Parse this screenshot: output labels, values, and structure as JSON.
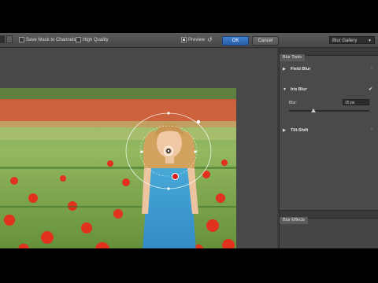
{
  "options": {
    "save_mask_label": "Save Mask to Channels",
    "high_quality_label": "High Quality",
    "preview_label": "Preview",
    "ok_label": "OK",
    "cancel_label": "Cancel",
    "gallery_value": "Blur Gallery"
  },
  "panel": {
    "tab_label": "Blur Tools",
    "items": [
      {
        "label": "Field Blur"
      },
      {
        "label": "Iris Blur"
      },
      {
        "label": "Tilt-Shift"
      }
    ],
    "blur_label": "Blur:",
    "blur_value": "15 px",
    "slider_value": 0.3,
    "effects_tab_label": "Blur Effects"
  },
  "colors": {
    "accent": "#2f6bbf",
    "pin_red": "#d22020"
  }
}
